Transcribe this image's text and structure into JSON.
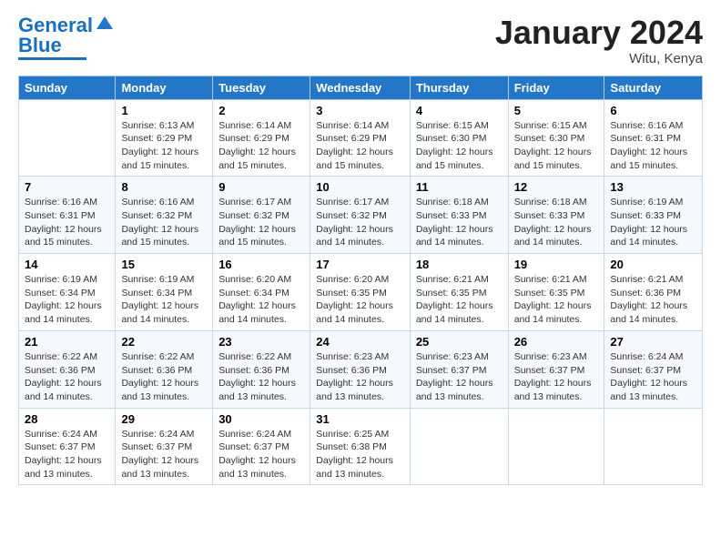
{
  "logo": {
    "part1": "General",
    "part2": "Blue"
  },
  "title": "January 2024",
  "location": "Witu, Kenya",
  "days_of_week": [
    "Sunday",
    "Monday",
    "Tuesday",
    "Wednesday",
    "Thursday",
    "Friday",
    "Saturday"
  ],
  "weeks": [
    [
      {
        "day": "",
        "info": ""
      },
      {
        "day": "1",
        "info": "Sunrise: 6:13 AM\nSunset: 6:29 PM\nDaylight: 12 hours\nand 15 minutes."
      },
      {
        "day": "2",
        "info": "Sunrise: 6:14 AM\nSunset: 6:29 PM\nDaylight: 12 hours\nand 15 minutes."
      },
      {
        "day": "3",
        "info": "Sunrise: 6:14 AM\nSunset: 6:29 PM\nDaylight: 12 hours\nand 15 minutes."
      },
      {
        "day": "4",
        "info": "Sunrise: 6:15 AM\nSunset: 6:30 PM\nDaylight: 12 hours\nand 15 minutes."
      },
      {
        "day": "5",
        "info": "Sunrise: 6:15 AM\nSunset: 6:30 PM\nDaylight: 12 hours\nand 15 minutes."
      },
      {
        "day": "6",
        "info": "Sunrise: 6:16 AM\nSunset: 6:31 PM\nDaylight: 12 hours\nand 15 minutes."
      }
    ],
    [
      {
        "day": "7",
        "info": "Sunrise: 6:16 AM\nSunset: 6:31 PM\nDaylight: 12 hours\nand 15 minutes."
      },
      {
        "day": "8",
        "info": "Sunrise: 6:16 AM\nSunset: 6:32 PM\nDaylight: 12 hours\nand 15 minutes."
      },
      {
        "day": "9",
        "info": "Sunrise: 6:17 AM\nSunset: 6:32 PM\nDaylight: 12 hours\nand 15 minutes."
      },
      {
        "day": "10",
        "info": "Sunrise: 6:17 AM\nSunset: 6:32 PM\nDaylight: 12 hours\nand 14 minutes."
      },
      {
        "day": "11",
        "info": "Sunrise: 6:18 AM\nSunset: 6:33 PM\nDaylight: 12 hours\nand 14 minutes."
      },
      {
        "day": "12",
        "info": "Sunrise: 6:18 AM\nSunset: 6:33 PM\nDaylight: 12 hours\nand 14 minutes."
      },
      {
        "day": "13",
        "info": "Sunrise: 6:19 AM\nSunset: 6:33 PM\nDaylight: 12 hours\nand 14 minutes."
      }
    ],
    [
      {
        "day": "14",
        "info": "Sunrise: 6:19 AM\nSunset: 6:34 PM\nDaylight: 12 hours\nand 14 minutes."
      },
      {
        "day": "15",
        "info": "Sunrise: 6:19 AM\nSunset: 6:34 PM\nDaylight: 12 hours\nand 14 minutes."
      },
      {
        "day": "16",
        "info": "Sunrise: 6:20 AM\nSunset: 6:34 PM\nDaylight: 12 hours\nand 14 minutes."
      },
      {
        "day": "17",
        "info": "Sunrise: 6:20 AM\nSunset: 6:35 PM\nDaylight: 12 hours\nand 14 minutes."
      },
      {
        "day": "18",
        "info": "Sunrise: 6:21 AM\nSunset: 6:35 PM\nDaylight: 12 hours\nand 14 minutes."
      },
      {
        "day": "19",
        "info": "Sunrise: 6:21 AM\nSunset: 6:35 PM\nDaylight: 12 hours\nand 14 minutes."
      },
      {
        "day": "20",
        "info": "Sunrise: 6:21 AM\nSunset: 6:36 PM\nDaylight: 12 hours\nand 14 minutes."
      }
    ],
    [
      {
        "day": "21",
        "info": "Sunrise: 6:22 AM\nSunset: 6:36 PM\nDaylight: 12 hours\nand 14 minutes."
      },
      {
        "day": "22",
        "info": "Sunrise: 6:22 AM\nSunset: 6:36 PM\nDaylight: 12 hours\nand 13 minutes."
      },
      {
        "day": "23",
        "info": "Sunrise: 6:22 AM\nSunset: 6:36 PM\nDaylight: 12 hours\nand 13 minutes."
      },
      {
        "day": "24",
        "info": "Sunrise: 6:23 AM\nSunset: 6:36 PM\nDaylight: 12 hours\nand 13 minutes."
      },
      {
        "day": "25",
        "info": "Sunrise: 6:23 AM\nSunset: 6:37 PM\nDaylight: 12 hours\nand 13 minutes."
      },
      {
        "day": "26",
        "info": "Sunrise: 6:23 AM\nSunset: 6:37 PM\nDaylight: 12 hours\nand 13 minutes."
      },
      {
        "day": "27",
        "info": "Sunrise: 6:24 AM\nSunset: 6:37 PM\nDaylight: 12 hours\nand 13 minutes."
      }
    ],
    [
      {
        "day": "28",
        "info": "Sunrise: 6:24 AM\nSunset: 6:37 PM\nDaylight: 12 hours\nand 13 minutes."
      },
      {
        "day": "29",
        "info": "Sunrise: 6:24 AM\nSunset: 6:37 PM\nDaylight: 12 hours\nand 13 minutes."
      },
      {
        "day": "30",
        "info": "Sunrise: 6:24 AM\nSunset: 6:37 PM\nDaylight: 12 hours\nand 13 minutes."
      },
      {
        "day": "31",
        "info": "Sunrise: 6:25 AM\nSunset: 6:38 PM\nDaylight: 12 hours\nand 13 minutes."
      },
      {
        "day": "",
        "info": ""
      },
      {
        "day": "",
        "info": ""
      },
      {
        "day": "",
        "info": ""
      }
    ]
  ]
}
